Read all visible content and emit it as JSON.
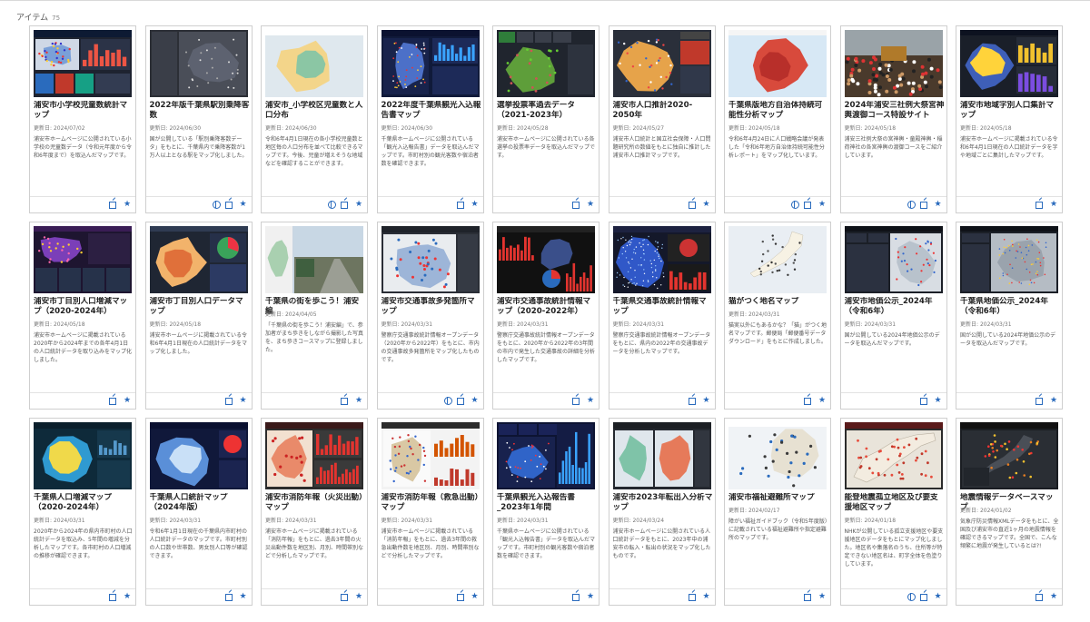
{
  "header": {
    "label": "アイテム",
    "count": "75"
  },
  "date_prefix": "更新日: ",
  "icons": {
    "star": "star-icon",
    "external": "external-link-icon",
    "globe": "globe-icon"
  },
  "items": [
    {
      "title": "浦安市小学校児童数統計マップ",
      "date": "2024/07/02",
      "desc": "浦安市ホームページに公開されている小学校の児童数データ（令和元年度から令和6年度まで）を取込んだマップです。",
      "globe": false,
      "thumb": "dash-dark"
    },
    {
      "title": "2022年版千葉県駅別乗降客数",
      "date": "2024/06/30",
      "desc": "国が公開している「駅別乗降客数データ」をもとに、千葉県内で乗降客数が1万人以上となる駅をマップ化しました。",
      "globe": true,
      "thumb": "dash-gray"
    },
    {
      "title": "浦安市_小学校区児童数と人口分布",
      "date": "2024/06/30",
      "desc": "令和6年4月1日現在の各小学校児童数と地区毎の人口分布を並べて比較できるマップです。今後、児童が増えそうな地域などを確認することができます。",
      "globe": true,
      "thumb": "map-light"
    },
    {
      "title": "2022年度千葉県観光入込報告書マップ",
      "date": "2024/06/30",
      "desc": "千葉県ホームページに公開されている「観光入込報告書」データを取込んだマップです。市町村別の観光客数や宿泊者数を確認できます。",
      "globe": false,
      "thumb": "dash-navy"
    },
    {
      "title": "選挙投票率過去データ（2021-2023年）",
      "date": "2024/05/28",
      "desc": "浦安市ホームページに公開されている各選挙の投票率データを取込んだマップです。",
      "globe": false,
      "thumb": "dash-green"
    },
    {
      "title": "浦安市人口推計2020-2050年",
      "date": "2024/05/27",
      "desc": "浦安市人口統計と国立社会保障・人口問題研究所の数値をもとに独自に推計した浦安市人口推計マップです。",
      "globe": false,
      "thumb": "dash-red"
    },
    {
      "title": "千葉県版地方自治体持続可能性分析マップ",
      "date": "2024/05/18",
      "desc": "令和6年4月24日に人口戦略会議が発表した「令和6年地方自治体持続可能性分析レポート」をマップ化しています。",
      "globe": true,
      "thumb": "map-chiba-red"
    },
    {
      "title": "2024年浦安三社例大祭宮神輿渡御コース特設サイト",
      "date": "2024/05/18",
      "desc": "浦安三社例大祭の宮神輿・童殿神輿・稲荷神社の各宮神輿の渡御コースをご紹介しています。",
      "globe": true,
      "thumb": "photo"
    },
    {
      "title": "浦安市地域字別人口集計マップ",
      "date": "2024/05/18",
      "desc": "浦安市ホームページに掲載されている令和6年4月1日現在の人口統計データを字や地域ごとに集計したマップです。",
      "globe": false,
      "thumb": "dash-blue"
    },
    {
      "title": "浦安市丁目別人口増減マップ（2020-2024年）",
      "date": "2024/05/18",
      "desc": "浦安市ホームページに掲載されている2020年から2024年までの各年4月1日の人口統計データを取り込みをマップ化しました。",
      "globe": false,
      "thumb": "dash-purple"
    },
    {
      "title": "浦安市丁目別人口データマップ",
      "date": "2024/05/18",
      "desc": "浦安市ホームページに掲載されている令和6年4月1日現在の人口統計データをマップ化しました。",
      "globe": false,
      "thumb": "dash-orange"
    },
    {
      "title": "千葉県の街を歩こう！浦安編",
      "date": "2024/04/05",
      "desc": "「千葉県の街を歩こう！浦安編」で、参加者がまち歩きをしながら撮影した写真を、まち歩きコースマップに登録しました。",
      "globe": false,
      "thumb": "photo-street"
    },
    {
      "title": "浦安市交通事故多発箇所マップ",
      "date": "2024/03/31",
      "desc": "警察庁交通事故統計情報オープンデータ（2020年から2022年）をもとに、市内の交通事故多発箇所をマップ化したものです。",
      "globe": true,
      "thumb": "dash-hex"
    },
    {
      "title": "浦安市交通事故統計情報マップ（2020-2022年）",
      "date": "2024/03/31",
      "desc": "警察庁交通事故統計情報オープンデータをもとに、2020年から2022年の3年間の市内で発生した交通事故の詳細を分析したマップです。",
      "globe": false,
      "thumb": "dash-bars"
    },
    {
      "title": "千葉県交通事故統計情報マップ",
      "date": "2024/03/31",
      "desc": "警察庁交通事故統計情報オープンデータをもとに、県内の2022年の交通事故データを分析したマップです。",
      "globe": false,
      "thumb": "dash-points"
    },
    {
      "title": "猫がつく地名マップ",
      "date": "2024/03/31",
      "desc": "猫実以外にもあるかな？「猫」がつく地名マップです。郵便局「郵便番号データダウンロード」をもとに作成しました。",
      "globe": false,
      "thumb": "map-japan"
    },
    {
      "title": "浦安市地価公示_2024年（令和6年）",
      "date": "2024/03/31",
      "desc": "国が公開している2024年地価公示のデータを取込んだマップです。",
      "globe": false,
      "thumb": "dash-land"
    },
    {
      "title": "千葉県地価公示_2024年（令和6年）",
      "date": "2024/03/31",
      "desc": "国が公開している2024年地価公示のデータを取込んだマップです。",
      "globe": false,
      "thumb": "dash-land2"
    },
    {
      "title": "千葉県人口増減マップ（2020-2024年）",
      "date": "2024/03/31",
      "desc": "2020年から2024年の県内市町村の人口統計データを取込み、5年間の増減を分析したマップです。各市町村の人口増減の推移が確認できます。",
      "globe": false,
      "thumb": "dash-chiba-blue"
    },
    {
      "title": "千葉県人口統計マップ（2024年版）",
      "date": "2024/03/31",
      "desc": "令和6年1月1日現在の千葉県内市町村の人口統計データのマップです。市町村別の人口数や世帯数、男女別人口等が確認できます。",
      "globe": false,
      "thumb": "dash-chiba-navy"
    },
    {
      "title": "浦安市消防年報（火災出動）マップ",
      "date": "2024/03/31",
      "desc": "浦安市ホームページに掲載されている「消防年報」をもとに、過去3年間の火災出動件数を地区別、月別、時間帯別などで分析したマップです。",
      "globe": false,
      "thumb": "dash-fire"
    },
    {
      "title": "浦安市消防年報（救急出動）マップ",
      "date": "2024/03/31",
      "desc": "浦安市ホームページに掲載されている「消防年報」をもとに、過去3年間の救急出動件数を地区別、月別、時間帯別などで分析したマップです。",
      "globe": false,
      "thumb": "dash-ambulance"
    },
    {
      "title": "千葉県観光入込報告書_2023年1年間",
      "date": "2024/03/31",
      "desc": "千葉県ホームページに公開されている「観光入込報告書」データを取込んだマップです。市町村別の観光客数や宿泊者数を確認できます。",
      "globe": false,
      "thumb": "dash-tourism"
    },
    {
      "title": "浦安市2023年転出入分析マップ",
      "date": "2024/03/24",
      "desc": "浦安市ホームページに公開されている人口統計データをもとに、2023年中の浦安市の転入・転出の状況をマップ化したものです。",
      "globe": false,
      "thumb": "dash-migration"
    },
    {
      "title": "浦安市福祉避難所マップ",
      "date": "2024/02/17",
      "desc": "障がい福祉ガイドブック（令和5年度版）に記載されている福祉避難所や指定避難所のマップです。",
      "globe": false,
      "thumb": "map-welfare"
    },
    {
      "title": "能登地震孤立地区及び要支援地区マップ",
      "date": "2024/01/18",
      "desc": "NHKが公開している孤立支援地区や要支援地区のデータをもとにマップ化しました。地区名や集落名のうち、住所等が特定できない地区名は、町字全体を色塗りしています。",
      "globe": true,
      "thumb": "map-noto"
    },
    {
      "title": "地震情報データベースマップ",
      "date": "2024/01/02",
      "desc": "気象庁防災情報XMLデータをもとに、全国及び浦安市の直近1ヶ月の地震情報を確認できるマップです。全国で、こんな頻繁に地震が発生しているとは?!",
      "globe": false,
      "thumb": "map-quake"
    }
  ]
}
